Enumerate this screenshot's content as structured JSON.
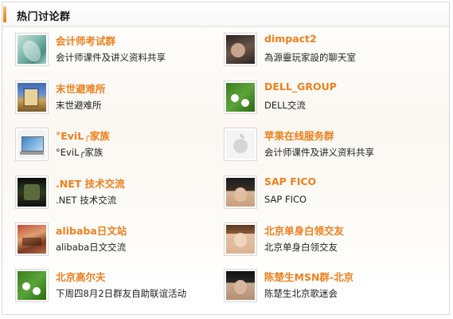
{
  "panel": {
    "title": "热门讨论群"
  },
  "groups": [
    {
      "name": "会计师考试群",
      "desc": "会计师课件及讲义资料共享",
      "avatar_icon": "teal-abstract-avatar"
    },
    {
      "name": "dimpact2",
      "desc": "為源靈玩家設的聊天室",
      "avatar_icon": "dark-portrait-avatar"
    },
    {
      "name": "末世避难所",
      "desc": "末世避难所",
      "avatar_icon": "castle-avatar"
    },
    {
      "name": "DELL_GROUP",
      "desc": "DELL交流",
      "avatar_icon": "green-logo-avatar"
    },
    {
      "name": "°EviL╭家族",
      "desc": "°EviL╭家族",
      "avatar_icon": "laptop-avatar"
    },
    {
      "name": "苹果在线服务群",
      "desc": "会计师课件及讲义资料共享",
      "avatar_icon": "apple-logo-avatar"
    },
    {
      "name": ".NET 技术交流",
      "desc": ".NET 技术交流",
      "avatar_icon": "film-avatar"
    },
    {
      "name": "SAP FICO",
      "desc": "SAP FICO",
      "avatar_icon": "man-portrait-avatar"
    },
    {
      "name": "alibaba日文站",
      "desc": "alibaba日文交流",
      "avatar_icon": "crowd-avatar"
    },
    {
      "name": "北京单身白领交友",
      "desc": "北京单身白领交友",
      "avatar_icon": "woman-portrait-avatar"
    },
    {
      "name": "北京高尔夫",
      "desc": "下周四8月2日群友自助联谊活动",
      "avatar_icon": "green-logo-avatar"
    },
    {
      "name": "陈楚生MSN群-北京",
      "desc": "陈楚生北京歌迷会",
      "avatar_icon": "singer-portrait-avatar"
    }
  ],
  "colors": {
    "accent": "#ef7f1b",
    "text": "#222222",
    "border": "#d8d8d8"
  }
}
